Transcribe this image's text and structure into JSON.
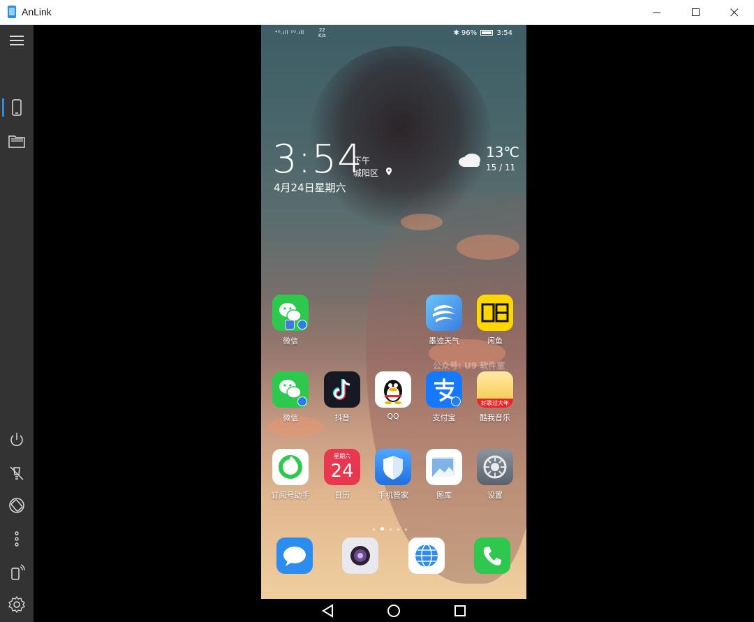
{
  "window": {
    "title": "AnLink",
    "controls": {
      "minimize": "minimize",
      "maximize": "maximize",
      "close": "close"
    }
  },
  "sidebar": {
    "items": [
      {
        "name": "menu",
        "icon": "hamburger-menu-icon"
      },
      {
        "name": "phone-screen",
        "icon": "phone-icon",
        "active": true
      },
      {
        "name": "file-manager",
        "icon": "folder-icon"
      },
      {
        "name": "power",
        "icon": "power-icon"
      },
      {
        "name": "screen-off",
        "icon": "screen-off-icon"
      },
      {
        "name": "rotate",
        "icon": "rotate-screen-icon"
      },
      {
        "name": "more",
        "icon": "more-vertical-icon"
      },
      {
        "name": "shake",
        "icon": "shake-phone-icon"
      },
      {
        "name": "settings",
        "icon": "gear-icon"
      }
    ]
  },
  "phone": {
    "status": {
      "signal": "⁴ᴳ.ıll ²ᴳ.ıll",
      "speed_value": "22",
      "speed_unit": "K/s",
      "battery": "96%",
      "time": "3:54"
    },
    "clock_widget": {
      "time": "3:54",
      "ampm": "下午",
      "district": "城阳区",
      "date": "4月24日星期六",
      "temperature": "13℃",
      "temp_range": "15 / 11"
    },
    "apps": [
      {
        "label": "微信",
        "color": "#2dc84d"
      },
      {
        "label": "墨迹天气",
        "color": "#4aa3f0"
      },
      {
        "label": "闲鱼",
        "color": "#ffd700"
      },
      {
        "label": "微信",
        "color": "#2dc84d"
      },
      {
        "label": "抖音",
        "color": "#161823"
      },
      {
        "label": "QQ",
        "color": "#ffffff"
      },
      {
        "label": "支付宝",
        "color": "#1677ff"
      },
      {
        "label": "酷我音乐",
        "color": "#f5c542"
      },
      {
        "label": "订阅号助手",
        "color": "#ffffff"
      },
      {
        "label": "日历",
        "color": "#e8384f",
        "day": "星期六",
        "number": "24"
      },
      {
        "label": "手机管家",
        "color": "#2f8cf0"
      },
      {
        "label": "图库",
        "color": "#ffffff"
      },
      {
        "label": "设置",
        "color": "#6b7480"
      }
    ],
    "dock": [
      {
        "name": "messages",
        "icon": "message-bubble-icon",
        "color": "#2d8cf0"
      },
      {
        "name": "camera",
        "icon": "camera-icon",
        "color": "#e8e8ee"
      },
      {
        "name": "browser",
        "icon": "globe-icon",
        "color": "#ffffff"
      },
      {
        "name": "phone",
        "icon": "phone-handset-icon",
        "color": "#2dc84d"
      }
    ],
    "kuwo_banner": "好歌过大年",
    "watermark": "公众号: U9 软件室"
  },
  "navbar": {
    "back": "back-triangle-icon",
    "home": "home-circle-icon",
    "recents": "recents-square-icon"
  }
}
